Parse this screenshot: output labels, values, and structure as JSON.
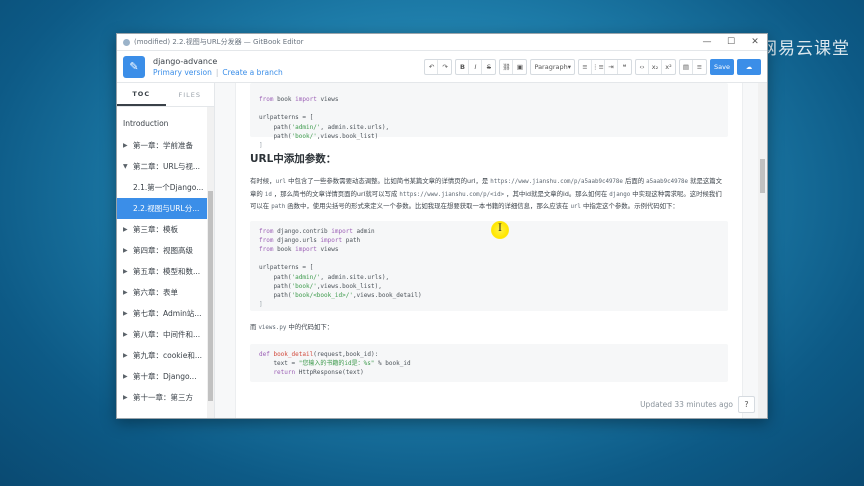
{
  "watermark": {
    "text": "网易云课堂"
  },
  "window": {
    "title": "(modified) 2.2.视图与URL分发器 — GitBook Editor",
    "controls": {
      "minimize": "—",
      "maximize": "☐",
      "close": "✕"
    }
  },
  "header": {
    "book_name": "django-advance",
    "branch_label": "Primary version",
    "create_branch": "Create a branch"
  },
  "toolbar": {
    "undo": "↶",
    "redo": "↷",
    "bold": "B",
    "italic": "I",
    "strike": "S",
    "link": "⛓",
    "image": "▣",
    "paragraph": "Paragraph",
    "ul": "≡",
    "ol": "⋮≡",
    "indent": "⇥",
    "quote": "❝",
    "code": "‹›",
    "sub": "x₂",
    "sup": "x²",
    "table": "▤",
    "align": "≡",
    "save": "Save",
    "publish": "☁"
  },
  "sidebar": {
    "tabs": [
      {
        "label": "TOC"
      },
      {
        "label": "FILES"
      }
    ],
    "items": [
      {
        "label": "Introduction"
      },
      {
        "label": "第一章：学前准备"
      },
      {
        "label": "第二章：URL与视..."
      },
      {
        "label": "2.1.第一个Django..."
      },
      {
        "label": "2.2.视图与URL分..."
      },
      {
        "label": "第三章：模板"
      },
      {
        "label": "第四章：视图高级"
      },
      {
        "label": "第五章：模型和数..."
      },
      {
        "label": "第六章：表单"
      },
      {
        "label": "第七章：Admin站..."
      },
      {
        "label": "第八章：中间件和..."
      },
      {
        "label": "第九章：cookie和..."
      },
      {
        "label": "第十章：Django..."
      },
      {
        "label": "第十一章：第三方"
      }
    ]
  },
  "content": {
    "heading": "URL中添加参数：",
    "para1": {
      "t1": "有时候，",
      "c1": "url",
      "t2": " 中包含了一些参数需要动态调整。比如简书某篇文章的详情页的url，是 ",
      "c2": "https://www.jianshu.com/p/a5aab9c4978e",
      "t3": " 后面的 ",
      "c3": "a5aab9c4978e",
      "t4": " 就是这篇文章的 ",
      "c4": "id",
      "t5": " ，那么简书的文章详情页面的url就可以写成 ",
      "c5": "https://www.jianshu.com/p/<id>",
      "t6": " ，其中id就是文章的id。那么如何在 ",
      "c6": "django",
      "t7": " 中实现这种需求呢。这时候我们可以在 ",
      "c7": "path",
      "t8": " 函数中，使用尖括号的形式来定义一个参数。比如我现在想要获取一本书籍的详细信息，那么应该在 ",
      "c8": "url",
      "t9": " 中指定这个参数。示例代码如下："
    },
    "para2": {
      "t1": "而 ",
      "c1": "views.py",
      "t2": " 中的代码如下："
    },
    "code1": {
      "l1a": "from",
      "l1b": " book ",
      "l1c": "import",
      "l1d": " views",
      "l3": "urlpatterns = [",
      "l4a": "    path(",
      "l4b": "'admin/'",
      "l4c": ", admin.site.urls),",
      "l5a": "    path(",
      "l5b": "'book/'",
      "l5c": ",views.book_list)",
      "l6": "]"
    },
    "code2": {
      "l1a": "from",
      "l1b": " django.contrib ",
      "l1c": "import",
      "l1d": " admin",
      "l2a": "from",
      "l2b": " django.urls ",
      "l2c": "import",
      "l2d": " path",
      "l3a": "from",
      "l3b": " book ",
      "l3c": "import",
      "l3d": " views",
      "l5": "urlpatterns = [",
      "l6a": "    path(",
      "l6b": "'admin/'",
      "l6c": ", admin.site.urls),",
      "l7a": "    path(",
      "l7b": "'book/'",
      "l7c": ",views.book_list),",
      "l8a": "    path(",
      "l8b": "'book/<book_id>/'",
      "l8c": ",views.book_detail)",
      "l9": "]"
    },
    "code3": {
      "l1a": "def",
      "l1b": " book_detail",
      "l1c": "(request,book_id):",
      "l2a": "    text = ",
      "l2b": "\"您输入的书籍的id是：%s\"",
      "l2c": " % book_id",
      "l3a": "    return",
      "l3b": " HttpResponse(text)"
    }
  },
  "status": {
    "updated": "Updated 33 minutes ago",
    "help": "?"
  }
}
